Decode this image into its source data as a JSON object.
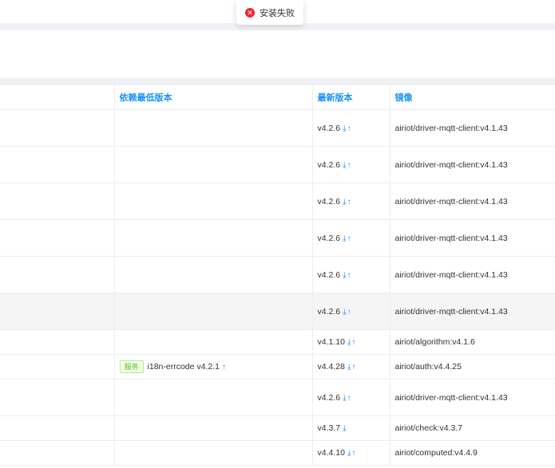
{
  "toast": {
    "text": "安装失败",
    "icon": "close-circle-icon",
    "color": "#f5222d"
  },
  "table": {
    "headers": {
      "col1": "",
      "col2": "依赖最低版本",
      "col3": "最新版本",
      "col4": "镜像"
    },
    "rows": [
      {
        "dep_tag": "",
        "dep": "",
        "version": "v4.2.6",
        "image": "airiot/driver-mqtt-client:v4.1.43"
      },
      {
        "dep_tag": "",
        "dep": "",
        "version": "v4.2.6",
        "image": "airiot/driver-mqtt-client:v4.1.43"
      },
      {
        "dep_tag": "",
        "dep": "",
        "version": "v4.2.6",
        "image": "airiot/driver-mqtt-client:v4.1.43"
      },
      {
        "dep_tag": "",
        "dep": "",
        "version": "v4.2.6",
        "image": "airiot/driver-mqtt-client:v4.1.43"
      },
      {
        "dep_tag": "",
        "dep": "",
        "version": "v4.2.6",
        "image": "airiot/driver-mqtt-client:v4.1.43"
      },
      {
        "dep_tag": "",
        "dep": "",
        "version": "v4.2.6",
        "image": "airiot/driver-mqtt-client:v4.1.43"
      },
      {
        "dep_tag": "",
        "dep": "",
        "version": "v4.1.10",
        "image": "airiot/algorithm:v4.1.6"
      },
      {
        "dep_tag": "服务",
        "dep": "i18n-errcode v4.2.1",
        "version": "v4.4.28",
        "image": "airiot/auth:v4.4.25"
      },
      {
        "dep_tag": "",
        "dep": "",
        "version": "v4.2.6",
        "image": "airiot/driver-mqtt-client:v4.1.43"
      },
      {
        "dep_tag": "",
        "dep": "",
        "version": "v4.3.7",
        "image": "airiot/check:v4.3.7"
      },
      {
        "dep_tag": "",
        "dep": "",
        "version": "v4.4.10",
        "image": "airiot/computed:v4.4.9"
      }
    ]
  }
}
